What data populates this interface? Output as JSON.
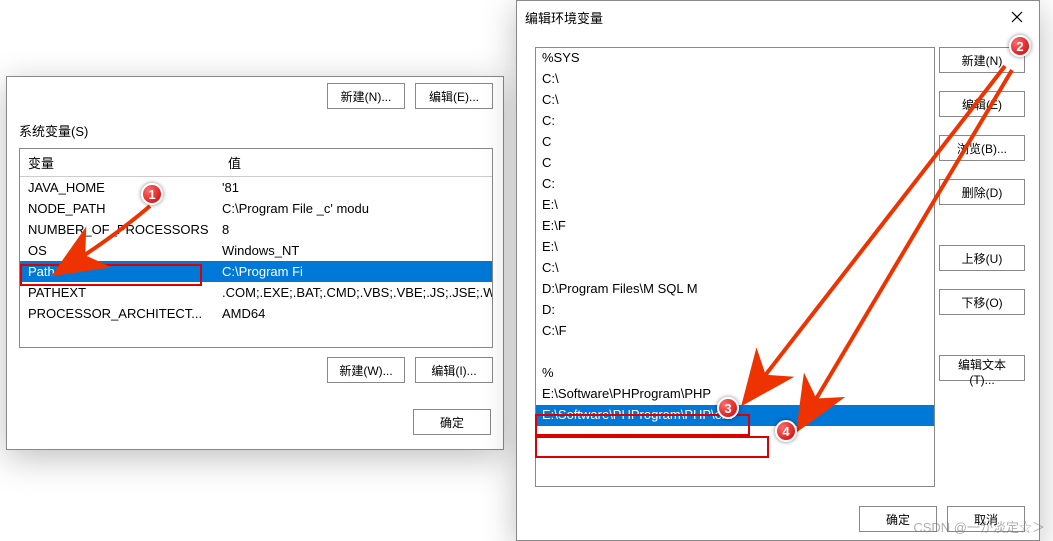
{
  "left": {
    "top_buttons": {
      "new": "新建(N)...",
      "edit": "编辑(E)..."
    },
    "sys_vars_label": "系统变量(S)",
    "columns": {
      "var": "变量",
      "val": "值"
    },
    "rows": [
      {
        "var": "JAVA_HOME",
        "val": "                                                    '81"
      },
      {
        "var": "NODE_PATH",
        "val": "C:\\Program File                        _c'                  modu"
      },
      {
        "var": "NUMBER_OF_PROCESSORS",
        "val": "8"
      },
      {
        "var": "OS",
        "val": "Windows_NT"
      },
      {
        "var": "Path",
        "val": "C:\\Program Fi"
      },
      {
        "var": "PATHEXT",
        "val": ".COM;.EXE;.BAT;.CMD;.VBS;.VBE;.JS;.JSE;.WSF;.WSH"
      },
      {
        "var": "PROCESSOR_ARCHITECT...",
        "val": "AMD64"
      }
    ],
    "selected_row_index": 4,
    "bottom_buttons": {
      "new": "新建(W)...",
      "edit": "编辑(I)..."
    },
    "ok": "确定"
  },
  "right": {
    "title": "编辑环境变量",
    "items": [
      "%SYS",
      "C:\\",
      "C:\\",
      "C:",
      "C",
      "C",
      "C:",
      "E:\\",
      "E:\\F",
      "E:\\",
      "C:\\",
      "D:\\Program  Files\\M  SQL M",
      "D:",
      "C:\\F",
      "",
      "%",
      "E:\\Software\\PHProgram\\PHP",
      "E:\\Software\\PHProgram\\PHP\\ext",
      ""
    ],
    "selected_index": 17,
    "buttons": {
      "new": "新建(N)",
      "edit": "编辑(E)",
      "browse": "浏览(B)...",
      "delete": "删除(D)",
      "up": "上移(U)",
      "down": "下移(O)",
      "edit_text": "编辑文本(T)..."
    },
    "footer": {
      "ok": "确定",
      "cancel": "取消"
    }
  },
  "markers": {
    "m1": "1",
    "m2": "2",
    "m3": "3",
    "m4": "4"
  },
  "watermark": "CSDN @一か淡定☆＞"
}
